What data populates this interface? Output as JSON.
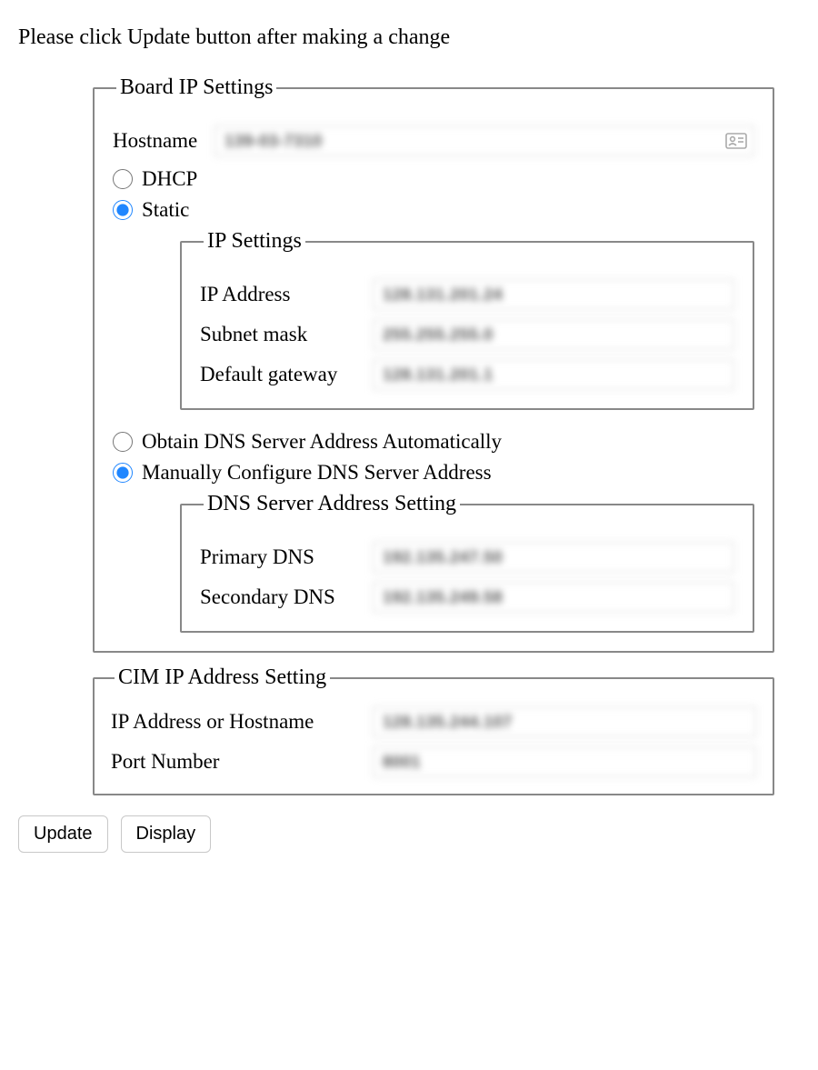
{
  "instruction": "Please click Update button after making a change",
  "board_settings": {
    "legend": "Board IP Settings",
    "hostname_label": "Hostname",
    "hostname_value": "139-03-7310",
    "mode_dhcp_label": "DHCP",
    "mode_static_label": "Static",
    "mode_selected": "static",
    "ip_settings": {
      "legend": "IP Settings",
      "ip_address_label": "IP Address",
      "ip_address_value": "128.131.201.24",
      "subnet_label": "Subnet mask",
      "subnet_value": "255.255.255.0",
      "gateway_label": "Default gateway",
      "gateway_value": "128.131.201.1"
    },
    "dns_auto_label": "Obtain DNS Server Address Automatically",
    "dns_manual_label": "Manually Configure DNS Server Address",
    "dns_mode_selected": "manual",
    "dns_settings": {
      "legend": "DNS Server Address Setting",
      "primary_label": "Primary DNS",
      "primary_value": "192.135.247.50",
      "secondary_label": "Secondary DNS",
      "secondary_value": "192.135.249.58"
    }
  },
  "cim": {
    "legend": "CIM IP Address Setting",
    "host_label": "IP Address or Hostname",
    "host_value": "128.135.244.107",
    "port_label": "Port Number",
    "port_value": "8001"
  },
  "buttons": {
    "update": "Update",
    "display": "Display"
  }
}
